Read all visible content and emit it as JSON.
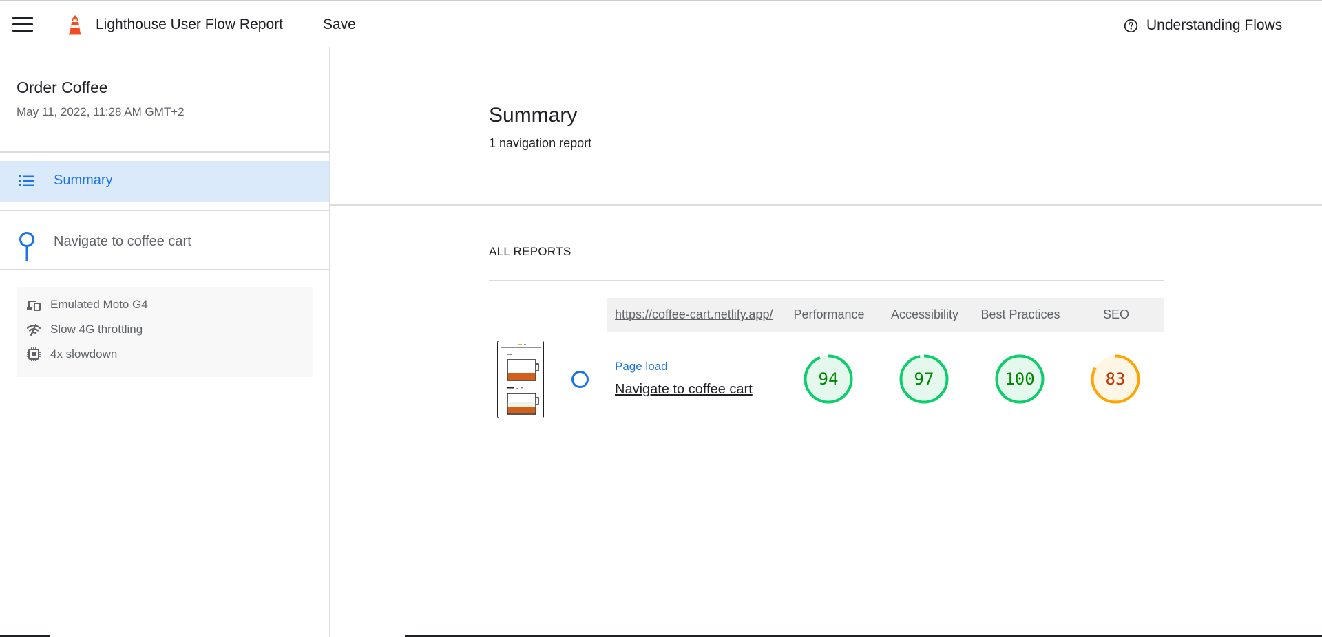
{
  "header": {
    "menu_icon": "hamburger-menu-icon",
    "logo_icon": "lighthouse-logo-icon",
    "title": "Lighthouse User Flow Report",
    "save_label": "Save",
    "help_icon": "help-circle-icon",
    "help_label": "Understanding Flows"
  },
  "sidebar": {
    "flow_title": "Order Coffee",
    "flow_date": "May 11, 2022, 11:28 AM GMT+2",
    "nav": [
      {
        "label": "Summary",
        "icon": "list-icon",
        "selected": true
      },
      {
        "label": "Navigate to coffee cart",
        "icon": "navigation-step-icon",
        "selected": false
      }
    ],
    "environment": [
      {
        "icon": "devices-icon",
        "label": "Emulated Moto G4"
      },
      {
        "icon": "network-icon",
        "label": "Slow 4G throttling"
      },
      {
        "icon": "cpu-icon",
        "label": "4x slowdown"
      }
    ]
  },
  "main": {
    "title": "Summary",
    "subtitle": "1 navigation report",
    "section_heading": "ALL REPORTS",
    "table": {
      "url": "https://coffee-cart.netlify.app/",
      "columns": [
        "Performance",
        "Accessibility",
        "Best Practices",
        "SEO"
      ],
      "rows": [
        {
          "type": "Page load",
          "name": "Navigate to coffee cart",
          "scores": [
            94,
            97,
            100,
            83
          ]
        }
      ]
    }
  },
  "colors": {
    "accent": "#1a73e8",
    "selected_nav_bg": "#dbeafb",
    "score_pass": "#0cce6b",
    "score_pass_text": "#008800",
    "score_pass_bg": "#e5f8ee",
    "score_average": "#ffa400",
    "score_average_text": "#c33300",
    "score_average_bg": "#fff6e6"
  }
}
